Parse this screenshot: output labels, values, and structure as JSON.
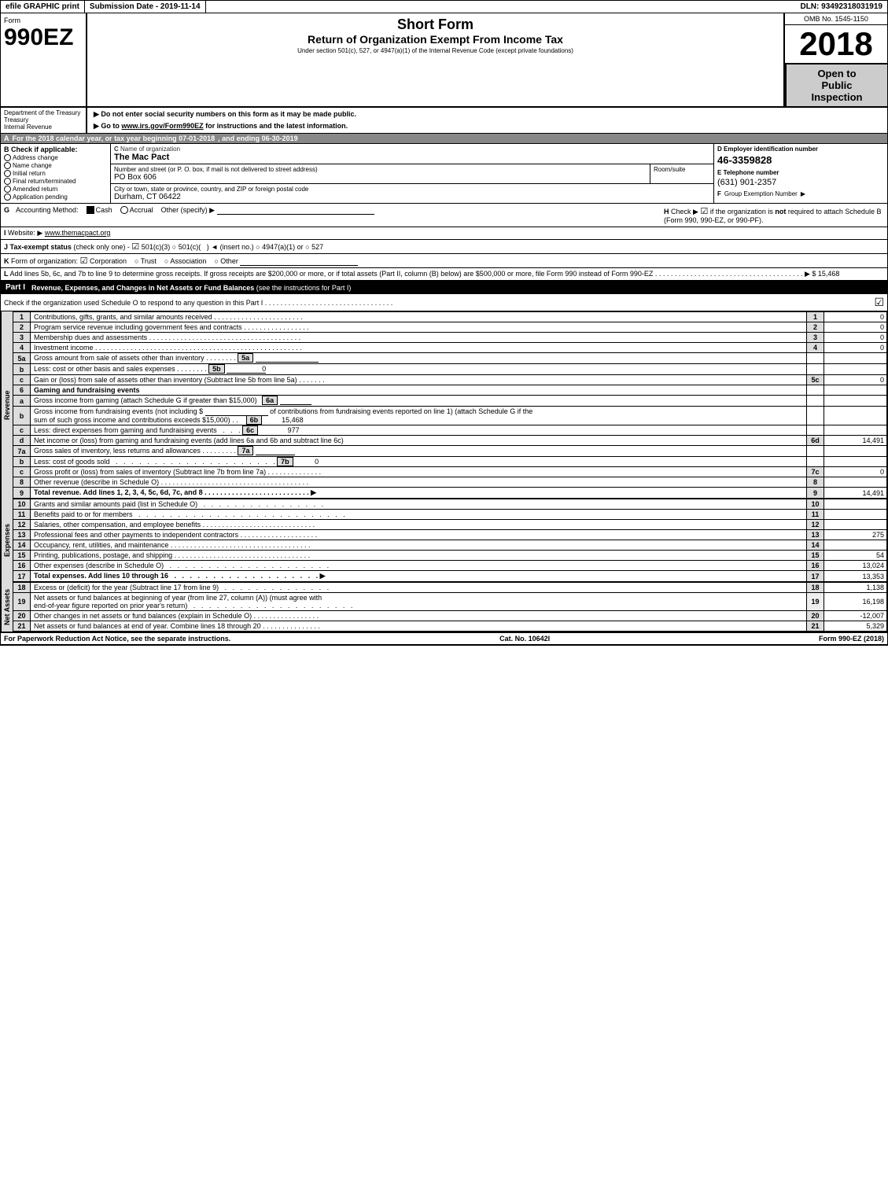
{
  "header": {
    "efile_label": "efile GRAPHIC print",
    "submission_label": "Submission Date - 2019-11-14",
    "dln_label": "DLN: 93492318031919"
  },
  "form": {
    "form_word": "Form",
    "form_number": "990EZ",
    "short_form": "Short Form",
    "return_title": "Return of Organization Exempt From Income Tax",
    "subtitle": "Under section 501(c), 527, or 4947(a)(1) of the Internal Revenue Code (except private foundations)",
    "year": "2018",
    "omb": "OMB No. 1545-1150",
    "open_to_public": "Open to\nPublic\nInspection",
    "instruction1": "▶ Do not enter social security numbers on this form as it may be made public.",
    "instruction2": "▶ Go to www.irs.gov/Form990EZ for instructions and the latest information.",
    "dept1": "Department of the Treasury",
    "dept2": "Internal Revenue"
  },
  "section_a": {
    "label": "A",
    "text": "For the 2018 calendar year, or tax year beginning 07-01-2018",
    "and_ending": ", and ending 06-30-2019"
  },
  "section_b": {
    "label": "B",
    "title": "Check if applicable:",
    "options": [
      "Address change",
      "Name change",
      "Initial return",
      "Final return/terminated",
      "Amended return",
      "Application pending"
    ]
  },
  "section_c": {
    "label": "C",
    "title": "Name of organization",
    "value": "The Mac Pact",
    "address_label": "Number and street (or P. O. box, if mail is not delivered to street address)",
    "address_value": "PO Box 606",
    "room_label": "Room/suite",
    "room_value": "",
    "city_label": "City or town, state or province, country, and ZIP or foreign postal code",
    "city_value": "Durham, CT  06422"
  },
  "section_d": {
    "label": "D",
    "title": "Employer identification number",
    "value": "46-3359828",
    "phone_label": "E Telephone number",
    "phone_value": "(631) 901-2357",
    "group_label": "F Group Exemption Number",
    "arrow": "▶"
  },
  "section_g": {
    "label": "G",
    "title": "Accounting Method:",
    "cash_label": "Cash",
    "accrual_label": "Accrual",
    "other_label": "Other (specify) ▶"
  },
  "section_h": {
    "label": "H",
    "text": "Check ▶ ☑ if the organization is not required to attach Schedule B (Form 990, 990-EZ, or 990-PF)."
  },
  "section_i": {
    "label": "I",
    "text": "Website: ▶www.themacpact.org"
  },
  "section_j": {
    "label": "J",
    "text": "Tax-exempt status (check only one) - ☑ 501(c)(3) ○ 501(c)( ) ◄ (insert no.) ○ 4947(a)(1) or ○ 527"
  },
  "section_k": {
    "label": "K",
    "text": "Form of organization: ☑ Corporation  ○ Trust  ○ Association  ○ Other"
  },
  "section_l": {
    "label": "L",
    "text": "Add lines 5b, 6c, and 7b to line 9 to determine gross receipts. If gross receipts are $200,000 or more, or if total assets (Part II, column (B) below) are $500,000 or more, file Form 990 instead of Form 990-EZ",
    "amount": "▶ $ 15,468"
  },
  "part1": {
    "label": "Part I",
    "title": "Revenue, Expenses, and Changes in Net Assets or Fund Balances",
    "subtitle": "(see the instructions for Part I)",
    "check_instruction": "Check if the organization used Schedule O to respond to any question in this Part I",
    "check_mark": "☑"
  },
  "revenue_lines": [
    {
      "num": "1",
      "desc": "Contributions, gifts, grants, and similar amounts received",
      "line_ref": "",
      "mid_val": "",
      "line_num": "1",
      "amount": "0"
    },
    {
      "num": "2",
      "desc": "Program service revenue including government fees and contracts",
      "line_ref": "",
      "mid_val": "",
      "line_num": "2",
      "amount": "0"
    },
    {
      "num": "3",
      "desc": "Membership dues and assessments",
      "line_ref": "",
      "mid_val": "",
      "line_num": "3",
      "amount": "0"
    },
    {
      "num": "4",
      "desc": "Investment income",
      "line_ref": "",
      "mid_val": "",
      "line_num": "4",
      "amount": "0"
    },
    {
      "num": "5a",
      "desc": "Gross amount from sale of assets other than inventory",
      "line_ref": "5a",
      "mid_val": "",
      "line_num": "",
      "amount": ""
    },
    {
      "num": "b",
      "desc": "Less: cost or other basis and sales expenses",
      "line_ref": "5b",
      "mid_val": "0",
      "line_num": "",
      "amount": ""
    },
    {
      "num": "c",
      "desc": "Gain or (loss) from sale of assets other than inventory (Subtract line 5b from line 5a)",
      "line_ref": "",
      "mid_val": "",
      "line_num": "5c",
      "amount": "0"
    },
    {
      "num": "6",
      "desc": "Gaming and fundraising events",
      "line_ref": "",
      "mid_val": "",
      "line_num": "",
      "amount": ""
    },
    {
      "num": "6a",
      "desc": "Gross income from gaming (attach Schedule G if greater than $15,000)",
      "line_ref": "6a",
      "mid_val": "",
      "line_num": "",
      "amount": ""
    },
    {
      "num": "6b",
      "desc": "Gross income from fundraising events (not including $_______________ of contributions from fundraising events reported on line 1) (attach Schedule G if the sum of such gross income and contributions exceeds $15,000)",
      "line_ref": "6b",
      "mid_val": "15,468",
      "line_num": "",
      "amount": ""
    },
    {
      "num": "6c",
      "desc": "Less: direct expenses from gaming and fundraising events",
      "line_ref": "6c",
      "mid_val": "977",
      "line_num": "",
      "amount": ""
    },
    {
      "num": "6d",
      "desc": "Net income or (loss) from gaming and fundraising events (add lines 6a and 6b and subtract line 6c)",
      "line_ref": "",
      "mid_val": "",
      "line_num": "6d",
      "amount": "14,491"
    },
    {
      "num": "7a",
      "desc": "Gross sales of inventory, less returns and allowances",
      "line_ref": "7a",
      "mid_val": "",
      "line_num": "",
      "amount": ""
    },
    {
      "num": "7b",
      "desc": "Less: cost of goods sold",
      "line_ref": "7b",
      "mid_val": "0",
      "line_num": "",
      "amount": ""
    },
    {
      "num": "7c",
      "desc": "Gross profit or (loss) from sales of inventory (Subtract line 7b from line 7a)",
      "line_ref": "",
      "mid_val": "",
      "line_num": "7c",
      "amount": "0"
    },
    {
      "num": "8",
      "desc": "Other revenue (describe in Schedule O)",
      "line_ref": "",
      "mid_val": "",
      "line_num": "8",
      "amount": ""
    },
    {
      "num": "9",
      "desc": "Total revenue. Add lines 1, 2, 3, 4, 5c, 6d, 7c, and 8",
      "line_ref": "",
      "mid_val": "",
      "line_num": "9",
      "amount": "14,491",
      "bold": true,
      "arrow": "▶"
    }
  ],
  "expense_lines": [
    {
      "num": "10",
      "desc": "Grants and similar amounts paid (list in Schedule O)",
      "line_ref": "",
      "mid_val": "",
      "line_num": "10",
      "amount": ""
    },
    {
      "num": "11",
      "desc": "Benefits paid to or for members",
      "line_ref": "",
      "mid_val": "",
      "line_num": "11",
      "amount": ""
    },
    {
      "num": "12",
      "desc": "Salaries, other compensation, and employee benefits",
      "line_ref": "",
      "mid_val": "",
      "line_num": "12",
      "amount": ""
    },
    {
      "num": "13",
      "desc": "Professional fees and other payments to independent contractors",
      "line_ref": "",
      "mid_val": "",
      "line_num": "13",
      "amount": "275"
    },
    {
      "num": "14",
      "desc": "Occupancy, rent, utilities, and maintenance",
      "line_ref": "",
      "mid_val": "",
      "line_num": "14",
      "amount": ""
    },
    {
      "num": "15",
      "desc": "Printing, publications, postage, and shipping",
      "line_ref": "",
      "mid_val": "",
      "line_num": "15",
      "amount": "54"
    },
    {
      "num": "16",
      "desc": "Other expenses (describe in Schedule O)",
      "line_ref": "",
      "mid_val": "",
      "line_num": "16",
      "amount": "13,024"
    },
    {
      "num": "17",
      "desc": "Total expenses. Add lines 10 through 16",
      "line_ref": "",
      "mid_val": "",
      "line_num": "17",
      "amount": "13,353",
      "bold": true,
      "arrow": "▶"
    }
  ],
  "net_assets_lines": [
    {
      "num": "18",
      "desc": "Excess or (deficit) for the year (Subtract line 17 from line 9)",
      "line_ref": "",
      "mid_val": "",
      "line_num": "18",
      "amount": "1,138"
    },
    {
      "num": "19",
      "desc": "Net assets or fund balances at beginning of year (from line 27, column (A)) (must agree with end-of-year figure reported on prior year's return)",
      "line_ref": "",
      "mid_val": "",
      "line_num": "19",
      "amount": "16,198"
    },
    {
      "num": "20",
      "desc": "Other changes in net assets or fund balances (explain in Schedule O)",
      "line_ref": "",
      "mid_val": "",
      "line_num": "20",
      "amount": "-12,007"
    },
    {
      "num": "21",
      "desc": "Net assets or fund balances at end of year. Combine lines 18 through 20",
      "line_ref": "",
      "mid_val": "",
      "line_num": "21",
      "amount": "5,329"
    }
  ],
  "footer": {
    "left": "For Paperwork Reduction Act Notice, see the separate instructions.",
    "cat": "Cat. No. 10642I",
    "right": "Form 990-EZ (2018)"
  }
}
